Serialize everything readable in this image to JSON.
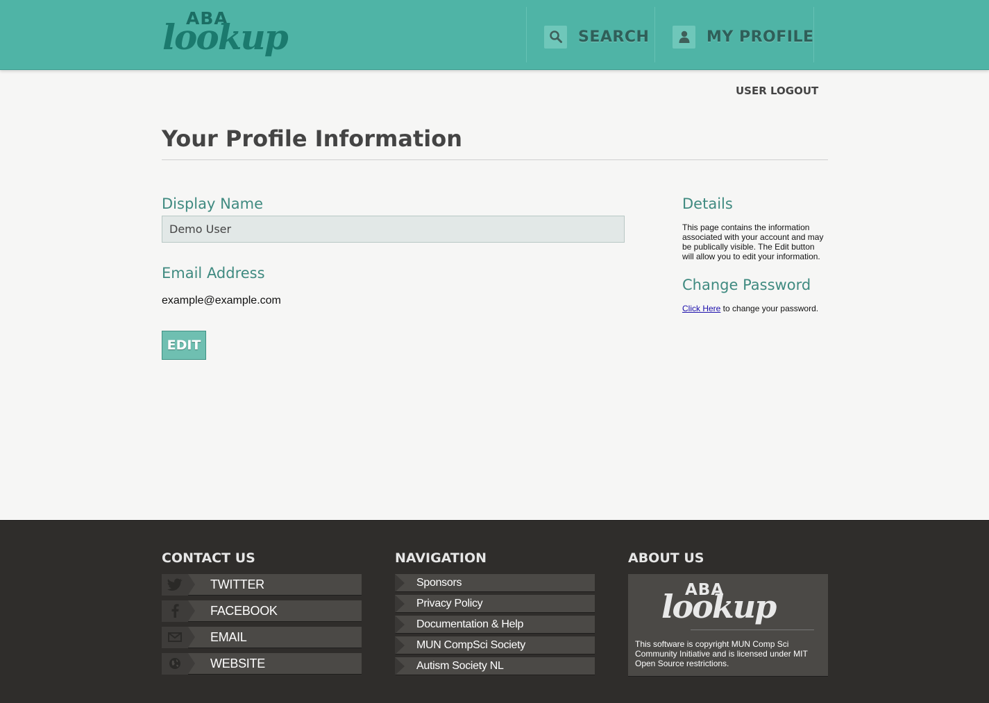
{
  "header": {
    "logo": {
      "aba": "ABA",
      "lookup": "lookup"
    },
    "nav": {
      "search_label": "SEARCH",
      "profile_label": "MY PROFILE"
    }
  },
  "logout_label": "USER LOGOUT",
  "page_title": "Your Profile Information",
  "form": {
    "display_name_label": "Display Name",
    "display_name_value": "Demo User",
    "email_label": "Email Address",
    "email_value": "example@example.com",
    "edit_label": "EDIT"
  },
  "sidebar": {
    "details_heading": "Details",
    "details_text": "This page contains the information associated with your account and may be publically visible. The Edit button will allow you to edit your information.",
    "change_password_heading": "Change Password",
    "change_password_link": "Click Here",
    "change_password_text": " to change your password."
  },
  "footer": {
    "contact_heading": "CONTACT US",
    "contact_items": [
      "TWITTER",
      "FACEBOOK",
      "EMAIL",
      "WEBSITE"
    ],
    "navigation_heading": "NAVIGATION",
    "navigation_items": [
      "Sponsors",
      "Privacy Policy",
      "Documentation & Help",
      "MUN CompSci Society",
      "Autism Society NL"
    ],
    "about_heading": "ABOUT US",
    "about_logo": {
      "aba": "ABA",
      "lookup": "lookup"
    },
    "about_text": "This software is copyright MUN Comp Sci Community Initiative and is licensed under MIT Open Source restrictions."
  },
  "colors": {
    "header": "#4fb4a6",
    "accent": "#3f8a80",
    "footer": "#2f2d2b",
    "button": "#6fbfb1"
  }
}
